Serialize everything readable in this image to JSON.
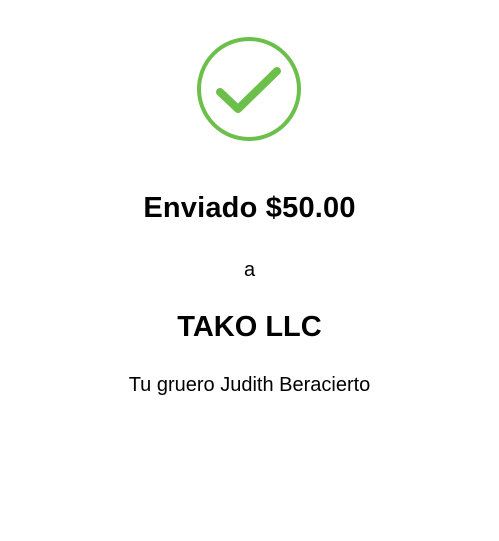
{
  "status_icon": {
    "name": "checkmark-circle-icon",
    "color": "#6cbf4a"
  },
  "confirmation": {
    "sent_label": "Enviado",
    "amount": "$50.00",
    "connector": "a",
    "recipient": "TAKO LLC",
    "memo": "Tu gruero Judith Beracierto"
  }
}
